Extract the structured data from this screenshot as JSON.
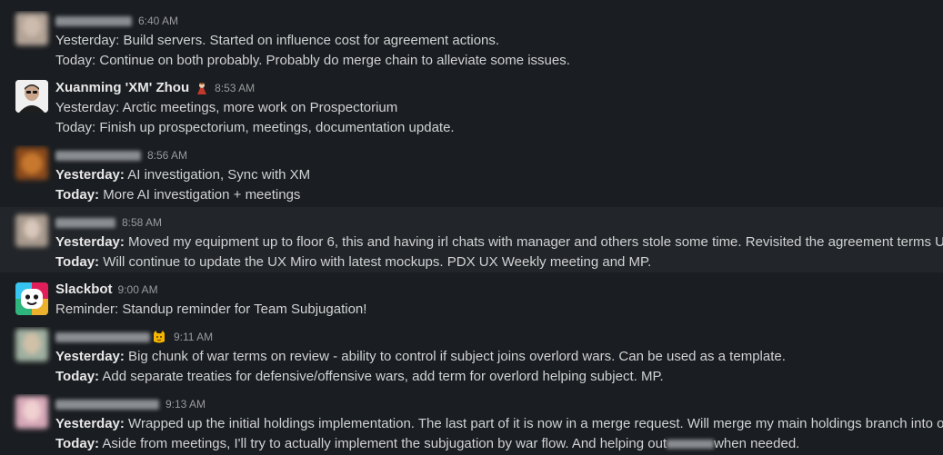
{
  "messages": [
    {
      "time": "6:40 AM",
      "yesterday_label": "Yesterday:",
      "yesterday_text": " Build servers. Started on influence cost for agreement actions.",
      "today_label": "Today:",
      "today_text": " Continue on both probably. Probably do merge chain to alleviate some issues.",
      "avatar_color": "#b3a397"
    },
    {
      "name": "Xuanming 'XM' Zhou",
      "time": "8:53 AM",
      "yesterday_label": "Yesterday:",
      "yesterday_text": " Arctic meetings, more work on Prospectorium",
      "today_label": "Today:",
      "today_text": " Finish up prospectorium, meetings, documentation update.",
      "avatar_color": "#f2f2f2"
    },
    {
      "time": "8:56 AM",
      "yesterday_label": "Yesterday:",
      "yesterday_text": " AI investigation, Sync with XM",
      "today_label": "Today:",
      "today_text": " More AI investigation + meetings",
      "avatar_color": "#8a4a1c"
    },
    {
      "time": "8:58 AM",
      "yesterday_label": "Yesterday:",
      "yesterday_text": " Moved my equipment up to floor 6, this and having irl chats with manager and others stole some time. Revisited the agreement terms UX r",
      "today_label": "Today:",
      "today_text": " Will continue to update the UX Miro with latest mockups. PDX UX Weekly meeting and MP.",
      "avatar_color": "#a89a8e"
    },
    {
      "name": "Slackbot",
      "time": "9:00 AM",
      "text": "Reminder: Standup reminder for Team Subjugation!",
      "avatar_color": "#4a154b"
    },
    {
      "time": "9:11 AM",
      "yesterday_label": "Yesterday:",
      "yesterday_text": " Big chunk of war terms on review - ability to control if subject joins overlord wars. Can be used as a template.",
      "today_label": "Today:",
      "today_text": " Add separate treaties for defensive/offensive wars, add term for overlord helping subject. MP.",
      "avatar_color": "#9fb0a0"
    },
    {
      "time": "9:13 AM",
      "yesterday_label": "Yesterday:",
      "yesterday_text": " Wrapped up the initial holdings implementation. The last part of it is now in a merge request. Will merge my main holdings branch into ove",
      "today_label": "Today:",
      "today_text_a": " Aside from meetings, I'll try to actually implement the subjugation by war flow. And helping out",
      "today_text_b": "when needed.",
      "avatar_color": "#d6a8b8"
    }
  ]
}
